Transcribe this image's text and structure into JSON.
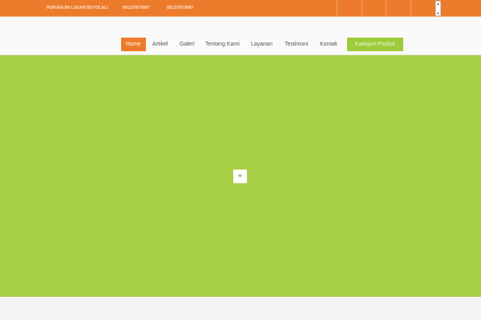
{
  "topbar": {
    "brand": "PENGRAJIN LOGAM BOYOLALI",
    "phone1": "081237670087",
    "phone2": "081237670087"
  },
  "nav": {
    "items": [
      "Home",
      "Artikel",
      "Galeri",
      "Tentang Kami",
      "Layanan",
      "Testimoni",
      "Kontak"
    ],
    "category": "Kategori Produk"
  },
  "colors": {
    "orange": "#ec7c2c",
    "green": "#a8d046"
  }
}
